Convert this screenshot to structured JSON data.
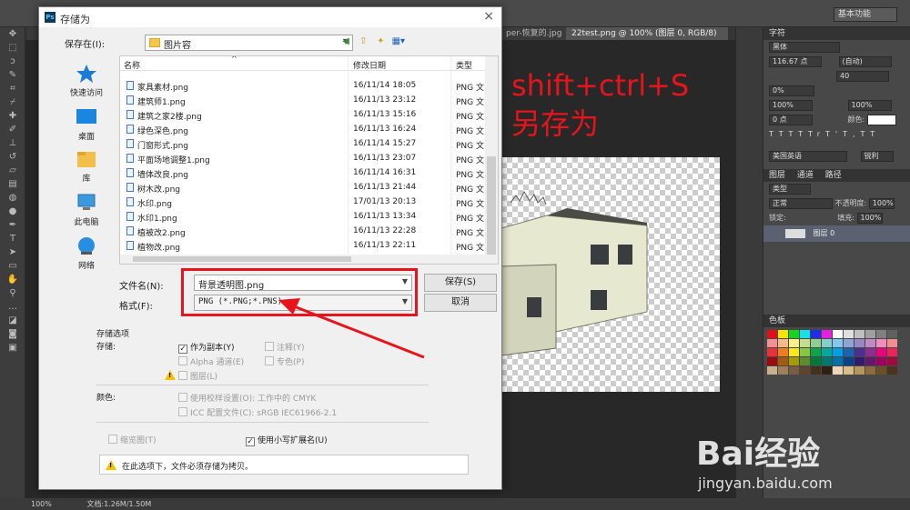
{
  "ps": {
    "workspace": "基本功能",
    "tabs": [
      "per-恢复的.jpg",
      "22test.png @ 100% (图层 0, RGB/8) *"
    ],
    "status_zoom": "100%",
    "status_doc": "文档:1.26M/1.50M",
    "char_panel": {
      "tab": "字符",
      "font": "黑体",
      "size": "116.67 点",
      "leading": "(自动)",
      "tracking": "40",
      "scale_v": "100%",
      "scale_h": "100%",
      "baseline": "0 点",
      "color_label": "颜色:",
      "kern": "0%",
      "lang": "美国英语",
      "aa": "锐利",
      "styles": [
        "T",
        "T",
        "TT",
        "Tr",
        "T'",
        "T,",
        "T",
        "T"
      ]
    },
    "layers_panel": {
      "tabs": [
        "图层",
        "通道",
        "路径"
      ],
      "filter": "类型",
      "blend": "正常",
      "opacity_label": "不透明度:",
      "opacity": "100%",
      "lock_label": "锁定:",
      "fill_label": "填充:",
      "fill": "100%",
      "layer_name": "图层 0"
    },
    "swatch_panel": {
      "tab": "色板"
    }
  },
  "annotation": {
    "line1": "shift+ctrl+S",
    "line2": "另存为"
  },
  "dialog": {
    "title": "存储为",
    "save_in_label": "保存在(I):",
    "folder": "图片容",
    "places": [
      {
        "label": "快速访问"
      },
      {
        "label": "桌面"
      },
      {
        "label": "库"
      },
      {
        "label": "此电脑"
      },
      {
        "label": "网络"
      }
    ],
    "columns": {
      "name": "名称",
      "date": "修改日期",
      "type": "类型"
    },
    "files": [
      {
        "name": "家具素材.png",
        "date": "16/11/14 18:05",
        "type": "PNG 文"
      },
      {
        "name": "建筑师1.png",
        "date": "16/11/13 23:12",
        "type": "PNG 文"
      },
      {
        "name": "建筑之家2楼.png",
        "date": "16/11/13 15:16",
        "type": "PNG 文"
      },
      {
        "name": "绿色深色.png",
        "date": "16/11/13 16:24",
        "type": "PNG 文"
      },
      {
        "name": "门窗形式.png",
        "date": "16/11/14 15:27",
        "type": "PNG 文"
      },
      {
        "name": "平面场地调整1.png",
        "date": "16/11/13 23:07",
        "type": "PNG 文"
      },
      {
        "name": "墙体改良.png",
        "date": "16/11/14 16:31",
        "type": "PNG 文"
      },
      {
        "name": "树木改.png",
        "date": "16/11/13 21:44",
        "type": "PNG 文"
      },
      {
        "name": "水印.png",
        "date": "17/01/13 20:13",
        "type": "PNG 文"
      },
      {
        "name": "水印1.png",
        "date": "16/11/13 13:34",
        "type": "PNG 文"
      },
      {
        "name": "植被改2.png",
        "date": "16/11/13 22:28",
        "type": "PNG 文"
      },
      {
        "name": "植物改.png",
        "date": "16/11/13 22:11",
        "type": "PNG 文"
      }
    ],
    "filename_label": "文件名(N):",
    "filename": "背景透明图.png",
    "format_label": "格式(F):",
    "format": "PNG (*.PNG;*.PNS)",
    "save_button": "保存(S)",
    "cancel_button": "取消",
    "options_title": "存储选项",
    "store_label": "存储:",
    "opts": {
      "as_copy": "作为副本(Y)",
      "notes": "注释(Y)",
      "alpha": "Alpha 通道(E)",
      "spot": "专色(P)",
      "layers": "图层(L)"
    },
    "color_label": "颜色:",
    "proof": "使用校样设置(O):  工作中的 CMYK",
    "icc": "ICC 配置文件(C):  sRGB IEC61966-2.1",
    "thumbnail": "缩览图(T)",
    "lowercase": "使用小写扩展名(U)",
    "note": "在此选项下，文件必须存储为拷贝。"
  },
  "watermark": {
    "brand": "Bai经验",
    "url": "jingyan.baidu.com"
  }
}
